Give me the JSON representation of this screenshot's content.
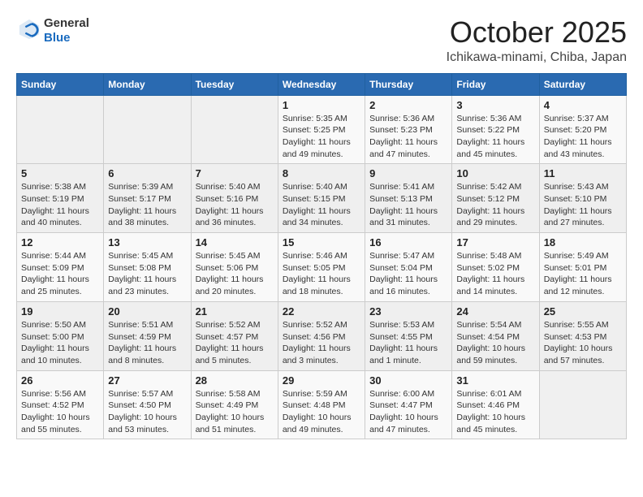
{
  "header": {
    "logo_general": "General",
    "logo_blue": "Blue",
    "month": "October 2025",
    "location": "Ichikawa-minami, Chiba, Japan"
  },
  "calendar": {
    "days_of_week": [
      "Sunday",
      "Monday",
      "Tuesday",
      "Wednesday",
      "Thursday",
      "Friday",
      "Saturday"
    ],
    "weeks": [
      [
        {
          "day": "",
          "info": ""
        },
        {
          "day": "",
          "info": ""
        },
        {
          "day": "",
          "info": ""
        },
        {
          "day": "1",
          "info": "Sunrise: 5:35 AM\nSunset: 5:25 PM\nDaylight: 11 hours and 49 minutes."
        },
        {
          "day": "2",
          "info": "Sunrise: 5:36 AM\nSunset: 5:23 PM\nDaylight: 11 hours and 47 minutes."
        },
        {
          "day": "3",
          "info": "Sunrise: 5:36 AM\nSunset: 5:22 PM\nDaylight: 11 hours and 45 minutes."
        },
        {
          "day": "4",
          "info": "Sunrise: 5:37 AM\nSunset: 5:20 PM\nDaylight: 11 hours and 43 minutes."
        }
      ],
      [
        {
          "day": "5",
          "info": "Sunrise: 5:38 AM\nSunset: 5:19 PM\nDaylight: 11 hours and 40 minutes."
        },
        {
          "day": "6",
          "info": "Sunrise: 5:39 AM\nSunset: 5:17 PM\nDaylight: 11 hours and 38 minutes."
        },
        {
          "day": "7",
          "info": "Sunrise: 5:40 AM\nSunset: 5:16 PM\nDaylight: 11 hours and 36 minutes."
        },
        {
          "day": "8",
          "info": "Sunrise: 5:40 AM\nSunset: 5:15 PM\nDaylight: 11 hours and 34 minutes."
        },
        {
          "day": "9",
          "info": "Sunrise: 5:41 AM\nSunset: 5:13 PM\nDaylight: 11 hours and 31 minutes."
        },
        {
          "day": "10",
          "info": "Sunrise: 5:42 AM\nSunset: 5:12 PM\nDaylight: 11 hours and 29 minutes."
        },
        {
          "day": "11",
          "info": "Sunrise: 5:43 AM\nSunset: 5:10 PM\nDaylight: 11 hours and 27 minutes."
        }
      ],
      [
        {
          "day": "12",
          "info": "Sunrise: 5:44 AM\nSunset: 5:09 PM\nDaylight: 11 hours and 25 minutes."
        },
        {
          "day": "13",
          "info": "Sunrise: 5:45 AM\nSunset: 5:08 PM\nDaylight: 11 hours and 23 minutes."
        },
        {
          "day": "14",
          "info": "Sunrise: 5:45 AM\nSunset: 5:06 PM\nDaylight: 11 hours and 20 minutes."
        },
        {
          "day": "15",
          "info": "Sunrise: 5:46 AM\nSunset: 5:05 PM\nDaylight: 11 hours and 18 minutes."
        },
        {
          "day": "16",
          "info": "Sunrise: 5:47 AM\nSunset: 5:04 PM\nDaylight: 11 hours and 16 minutes."
        },
        {
          "day": "17",
          "info": "Sunrise: 5:48 AM\nSunset: 5:02 PM\nDaylight: 11 hours and 14 minutes."
        },
        {
          "day": "18",
          "info": "Sunrise: 5:49 AM\nSunset: 5:01 PM\nDaylight: 11 hours and 12 minutes."
        }
      ],
      [
        {
          "day": "19",
          "info": "Sunrise: 5:50 AM\nSunset: 5:00 PM\nDaylight: 11 hours and 10 minutes."
        },
        {
          "day": "20",
          "info": "Sunrise: 5:51 AM\nSunset: 4:59 PM\nDaylight: 11 hours and 8 minutes."
        },
        {
          "day": "21",
          "info": "Sunrise: 5:52 AM\nSunset: 4:57 PM\nDaylight: 11 hours and 5 minutes."
        },
        {
          "day": "22",
          "info": "Sunrise: 5:52 AM\nSunset: 4:56 PM\nDaylight: 11 hours and 3 minutes."
        },
        {
          "day": "23",
          "info": "Sunrise: 5:53 AM\nSunset: 4:55 PM\nDaylight: 11 hours and 1 minute."
        },
        {
          "day": "24",
          "info": "Sunrise: 5:54 AM\nSunset: 4:54 PM\nDaylight: 10 hours and 59 minutes."
        },
        {
          "day": "25",
          "info": "Sunrise: 5:55 AM\nSunset: 4:53 PM\nDaylight: 10 hours and 57 minutes."
        }
      ],
      [
        {
          "day": "26",
          "info": "Sunrise: 5:56 AM\nSunset: 4:52 PM\nDaylight: 10 hours and 55 minutes."
        },
        {
          "day": "27",
          "info": "Sunrise: 5:57 AM\nSunset: 4:50 PM\nDaylight: 10 hours and 53 minutes."
        },
        {
          "day": "28",
          "info": "Sunrise: 5:58 AM\nSunset: 4:49 PM\nDaylight: 10 hours and 51 minutes."
        },
        {
          "day": "29",
          "info": "Sunrise: 5:59 AM\nSunset: 4:48 PM\nDaylight: 10 hours and 49 minutes."
        },
        {
          "day": "30",
          "info": "Sunrise: 6:00 AM\nSunset: 4:47 PM\nDaylight: 10 hours and 47 minutes."
        },
        {
          "day": "31",
          "info": "Sunrise: 6:01 AM\nSunset: 4:46 PM\nDaylight: 10 hours and 45 minutes."
        },
        {
          "day": "",
          "info": ""
        }
      ]
    ]
  }
}
